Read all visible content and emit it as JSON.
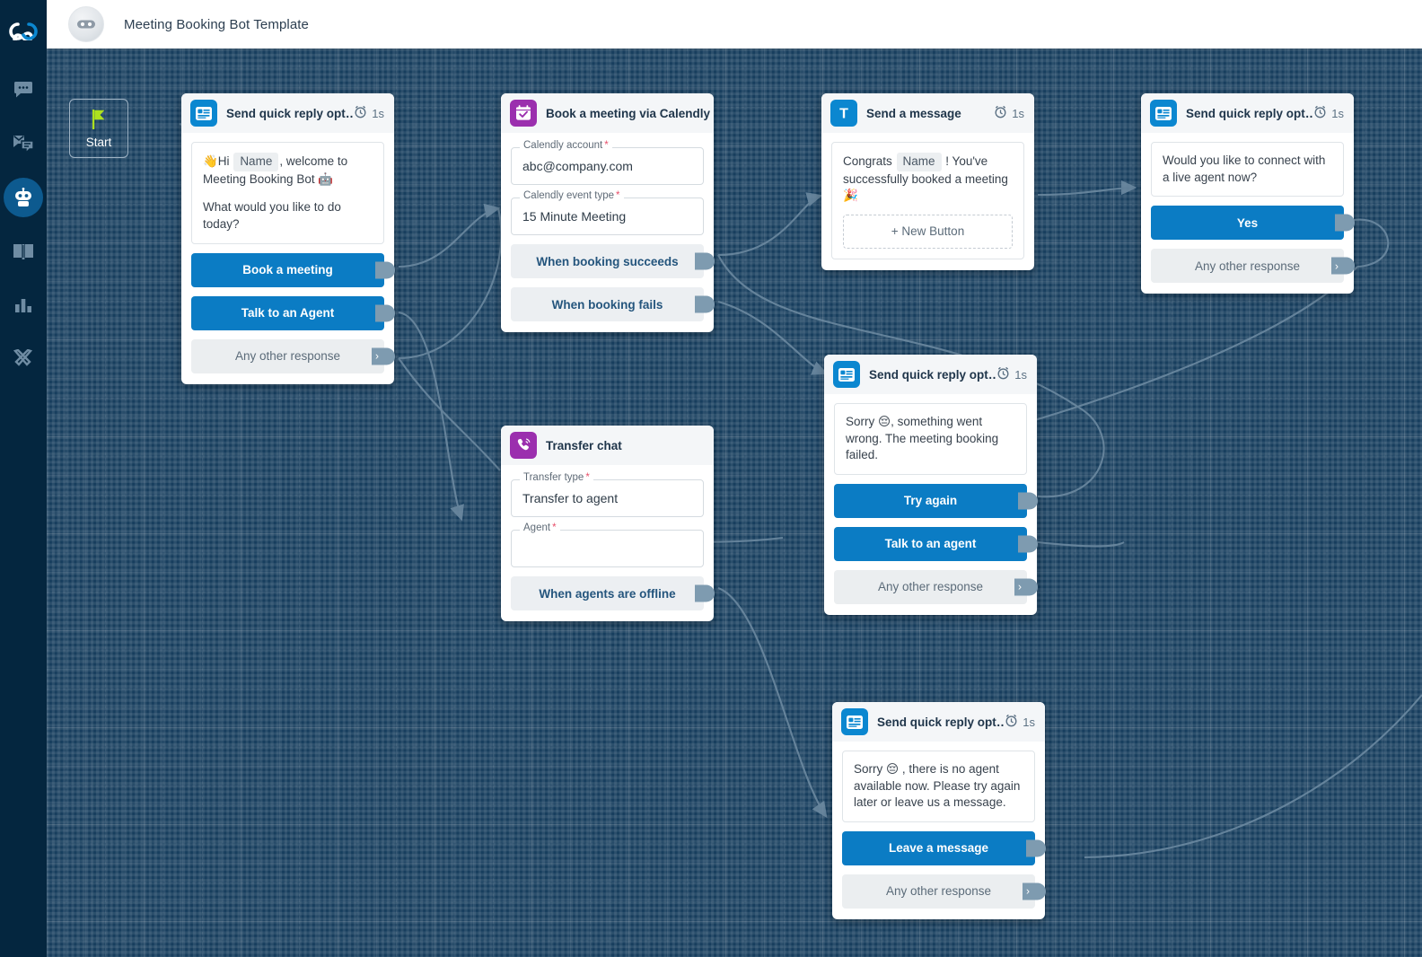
{
  "app": {
    "logo_icon": "infinity-logo-icon",
    "avatar_icon": "bot-avatar-icon",
    "title": "Meeting Booking Bot Template"
  },
  "colors": {
    "rail_bg": "#04263f",
    "canvas_bg": "#173e5e",
    "accent_blue": "#0b7cc4",
    "icon_blue": "#0b87d0",
    "icon_purple": "#9b2fae",
    "port": "#7e9bb0",
    "edge": "#6f8ca3",
    "required_star": "#e8506b",
    "outcome_text": "#24557d"
  },
  "sidebar": {
    "items": [
      {
        "name": "chat",
        "icon": "chat-bubble-icon",
        "active": false
      },
      {
        "name": "archives",
        "icon": "archived-chats-icon",
        "active": false
      },
      {
        "name": "chatbots",
        "icon": "robot-icon",
        "active": true
      },
      {
        "name": "knowledge",
        "icon": "book-icon",
        "active": false
      },
      {
        "name": "reports",
        "icon": "bar-chart-icon",
        "active": false
      },
      {
        "name": "settings",
        "icon": "tools-icon",
        "active": false
      }
    ]
  },
  "canvas": {
    "start_node": {
      "label": "Start",
      "icon": "green-flag-icon"
    },
    "nodes": [
      {
        "id": "quick-reply-welcome",
        "title": "Send quick reply opt…",
        "icon": "quick-reply-icon",
        "icon_color": "blue",
        "delay": "1s",
        "message_lines": [
          {
            "parts": [
              {
                "t": "emoji",
                "v": "👋"
              },
              {
                "t": "text",
                "v": "Hi "
              },
              {
                "t": "chip",
                "v": "Name"
              },
              {
                "t": "text",
                "v": ", welcome to Meeting Booking Bot 🤖"
              }
            ]
          },
          {
            "parts": [
              {
                "t": "text",
                "v": "What would you like to do today?"
              }
            ]
          }
        ],
        "buttons": [
          {
            "label": "Book a meeting",
            "style": "blue",
            "port": "knob"
          },
          {
            "label": "Talk to an Agent",
            "style": "blue",
            "port": "knob"
          },
          {
            "label": "Any other response",
            "style": "grey",
            "port": "chevron"
          }
        ]
      },
      {
        "id": "calendly",
        "title": "Book a meeting via Calendly",
        "icon": "calendar-check-icon",
        "icon_color": "purple",
        "delay": "",
        "fields": [
          {
            "label": "Calendly account",
            "required": true,
            "value": "abc@company.com"
          },
          {
            "label": "Calendly event type",
            "required": true,
            "value": "15 Minute Meeting"
          }
        ],
        "buttons": [
          {
            "label": "When booking succeeds",
            "style": "outcome",
            "port": "knob"
          },
          {
            "label": "When booking fails",
            "style": "outcome",
            "port": "knob"
          }
        ]
      },
      {
        "id": "send-message-congrats",
        "title": "Send a message",
        "icon": "text-message-icon",
        "icon_color": "blue",
        "delay": "1s",
        "message_lines": [
          {
            "parts": [
              {
                "t": "text",
                "v": "Congrats "
              },
              {
                "t": "chip",
                "v": "Name"
              },
              {
                "t": "text",
                "v": " ! You've successfully booked a meeting 🎉"
              }
            ]
          }
        ],
        "new_button_label": "+ New Button"
      },
      {
        "id": "quick-reply-live-agent",
        "title": "Send quick reply opt…",
        "icon": "quick-reply-icon",
        "icon_color": "blue",
        "delay": "1s",
        "message_lines": [
          {
            "parts": [
              {
                "t": "text",
                "v": "Would you like to connect with a live agent now?"
              }
            ]
          }
        ],
        "buttons": [
          {
            "label": "Yes",
            "style": "blue",
            "port": "knob"
          },
          {
            "label": "Any other response",
            "style": "grey",
            "port": "chevron"
          }
        ]
      },
      {
        "id": "transfer-chat",
        "title": "Transfer chat",
        "icon": "phone-transfer-icon",
        "icon_color": "purple",
        "delay": "",
        "fields": [
          {
            "label": "Transfer type",
            "required": true,
            "value": "Transfer to agent"
          },
          {
            "label": "Agent",
            "required": true,
            "value": ""
          }
        ],
        "buttons": [
          {
            "label": "When agents are offline",
            "style": "outcome",
            "port": "knob"
          }
        ]
      },
      {
        "id": "quick-reply-booking-failed",
        "title": "Send quick reply opt…",
        "icon": "quick-reply-icon",
        "icon_color": "blue",
        "delay": "1s",
        "message_lines": [
          {
            "parts": [
              {
                "t": "text",
                "v": "Sorry 😔, something went wrong. The meeting booking failed."
              }
            ]
          }
        ],
        "buttons": [
          {
            "label": "Try again",
            "style": "blue",
            "port": "knob"
          },
          {
            "label": "Talk to an agent",
            "style": "blue",
            "port": "knob"
          },
          {
            "label": "Any other response",
            "style": "grey",
            "port": "chevron"
          }
        ]
      },
      {
        "id": "quick-reply-no-agent",
        "title": "Send quick reply opt…",
        "icon": "quick-reply-icon",
        "icon_color": "blue",
        "delay": "1s",
        "message_lines": [
          {
            "parts": [
              {
                "t": "text",
                "v": "Sorry 😔 , there is no agent available now. Please try again later or leave us a message."
              }
            ]
          }
        ],
        "buttons": [
          {
            "label": "Leave a message",
            "style": "blue",
            "port": "knob"
          },
          {
            "label": "Any other response",
            "style": "grey",
            "port": "chevron"
          }
        ]
      }
    ]
  }
}
